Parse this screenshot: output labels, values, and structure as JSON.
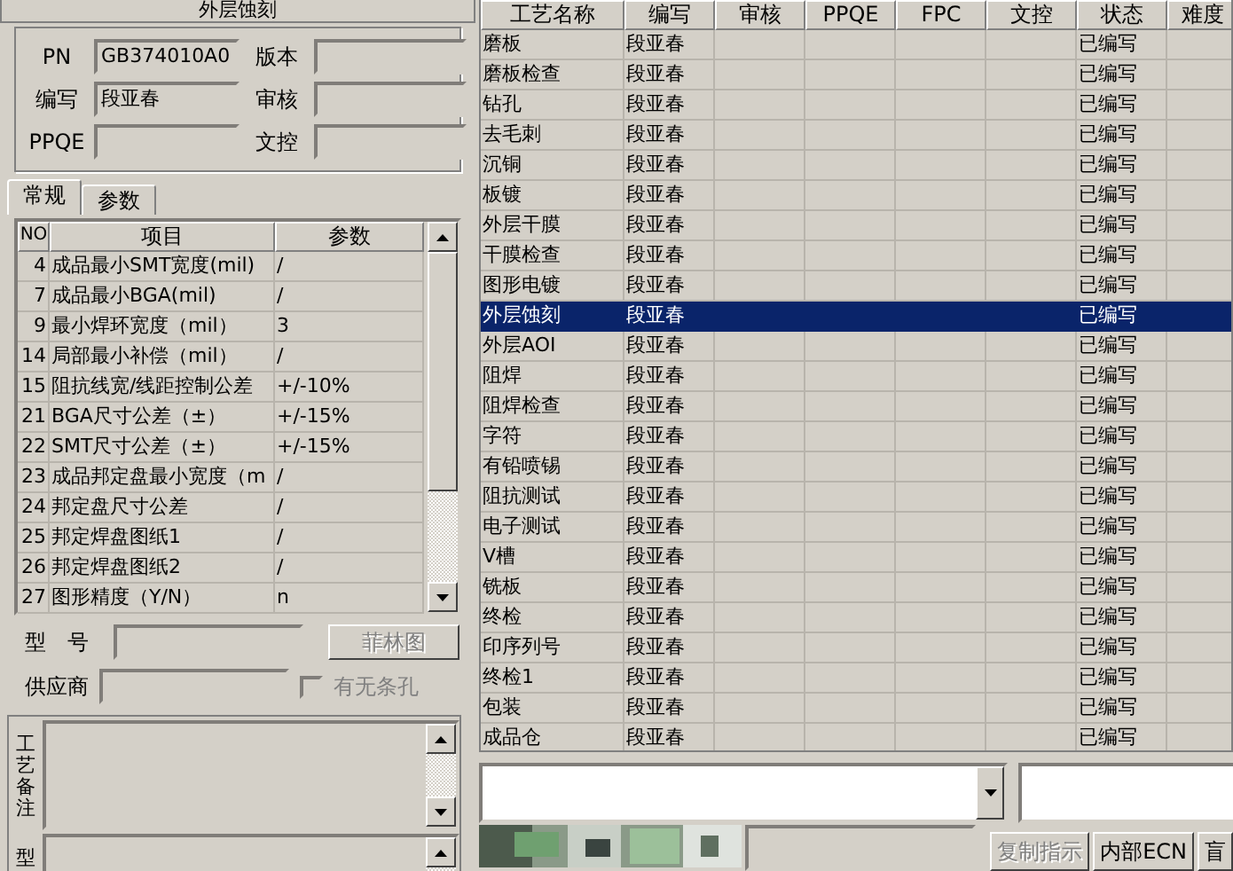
{
  "title": "外层蚀刻",
  "fields": [
    {
      "label": "PN",
      "value": "GB374010A0"
    },
    {
      "label": "版本"
    },
    {
      "label": "编写",
      "value": "段亚春"
    },
    {
      "label": "审核"
    },
    {
      "label": "PPQE"
    },
    {
      "label": "文控"
    }
  ],
  "tabs": [
    {
      "label": "常规",
      "selected": true
    },
    {
      "label": "参数",
      "selected": false
    }
  ],
  "param_table": {
    "columns": [
      "NO",
      "项目",
      "参数"
    ],
    "rows": [
      [
        "4",
        "成品最小SMT宽度(mil)",
        "/"
      ],
      [
        "7",
        "成品最小BGA(mil)",
        "/"
      ],
      [
        "9",
        "最小焊环宽度（mil）",
        "3"
      ],
      [
        "14",
        "局部最小补偿（mil）",
        "/"
      ],
      [
        "15",
        "阻抗线宽/线距控制公差",
        "+/-10%"
      ],
      [
        "21",
        "BGA尺寸公差（±）",
        "+/-15%"
      ],
      [
        "22",
        "SMT尺寸公差（±）",
        "+/-15%"
      ],
      [
        "23",
        "成品邦定盘最小宽度（m",
        "/"
      ],
      [
        "24",
        "邦定盘尺寸公差",
        "/"
      ],
      [
        "25",
        "邦定焊盘图纸1",
        "/"
      ],
      [
        "26",
        "邦定焊盘图纸2",
        "/"
      ],
      [
        "27",
        "图形精度（Y/N）",
        "n"
      ]
    ]
  },
  "model_label": "型　号",
  "film_button": {
    "label": "菲林图",
    "disabled": true
  },
  "supplier_label": "供应商",
  "checkbox": {
    "label": "有无条孔",
    "checked": false,
    "disabled": true
  },
  "memo_labels": [
    "工艺备注",
    "型"
  ],
  "process_table": {
    "columns": [
      "工艺名称",
      "编写",
      "审核",
      "PPQE",
      "FPC",
      "文控",
      "状态",
      "难度"
    ],
    "rows": [
      {
        "name": "磨板",
        "writer": "段亚春",
        "status": "已编写",
        "selected": false
      },
      {
        "name": "磨板检查",
        "writer": "段亚春",
        "status": "已编写",
        "selected": false
      },
      {
        "name": "钻孔",
        "writer": "段亚春",
        "status": "已编写",
        "selected": false
      },
      {
        "name": "去毛刺",
        "writer": "段亚春",
        "status": "已编写",
        "selected": false
      },
      {
        "name": "沉铜",
        "writer": "段亚春",
        "status": "已编写",
        "selected": false
      },
      {
        "name": "板镀",
        "writer": "段亚春",
        "status": "已编写",
        "selected": false
      },
      {
        "name": "外层干膜",
        "writer": "段亚春",
        "status": "已编写",
        "selected": false
      },
      {
        "name": "干膜检查",
        "writer": "段亚春",
        "status": "已编写",
        "selected": false
      },
      {
        "name": "图形电镀",
        "writer": "段亚春",
        "status": "已编写",
        "selected": false
      },
      {
        "name": "外层蚀刻",
        "writer": "段亚春",
        "status": "已编写",
        "selected": true
      },
      {
        "name": "外层AOI",
        "writer": "段亚春",
        "status": "已编写",
        "selected": false
      },
      {
        "name": "阻焊",
        "writer": "段亚春",
        "status": "已编写",
        "selected": false
      },
      {
        "name": "阻焊检查",
        "writer": "段亚春",
        "status": "已编写",
        "selected": false
      },
      {
        "name": "字符",
        "writer": "段亚春",
        "status": "已编写",
        "selected": false
      },
      {
        "name": "有铅喷锡",
        "writer": "段亚春",
        "status": "已编写",
        "selected": false
      },
      {
        "name": "阻抗测试",
        "writer": "段亚春",
        "status": "已编写",
        "selected": false
      },
      {
        "name": "电子测试",
        "writer": "段亚春",
        "status": "已编写",
        "selected": false
      },
      {
        "name": "V槽",
        "writer": "段亚春",
        "status": "已编写",
        "selected": false
      },
      {
        "name": "铣板",
        "writer": "段亚春",
        "status": "已编写",
        "selected": false
      },
      {
        "name": "终检",
        "writer": "段亚春",
        "status": "已编写",
        "selected": false
      },
      {
        "name": "印序列号",
        "writer": "段亚春",
        "status": "已编写",
        "selected": false
      },
      {
        "name": "终检1",
        "writer": "段亚春",
        "status": "已编写",
        "selected": false
      },
      {
        "name": "包装",
        "writer": "段亚春",
        "status": "已编写",
        "selected": false
      },
      {
        "name": "成品仓",
        "writer": "段亚春",
        "status": "已编写",
        "selected": false
      }
    ]
  },
  "bottom_buttons": [
    {
      "label": "复制指示",
      "disabled": true
    },
    {
      "label": "内部ECN",
      "disabled": false
    },
    {
      "label": "盲",
      "disabled": false
    }
  ]
}
